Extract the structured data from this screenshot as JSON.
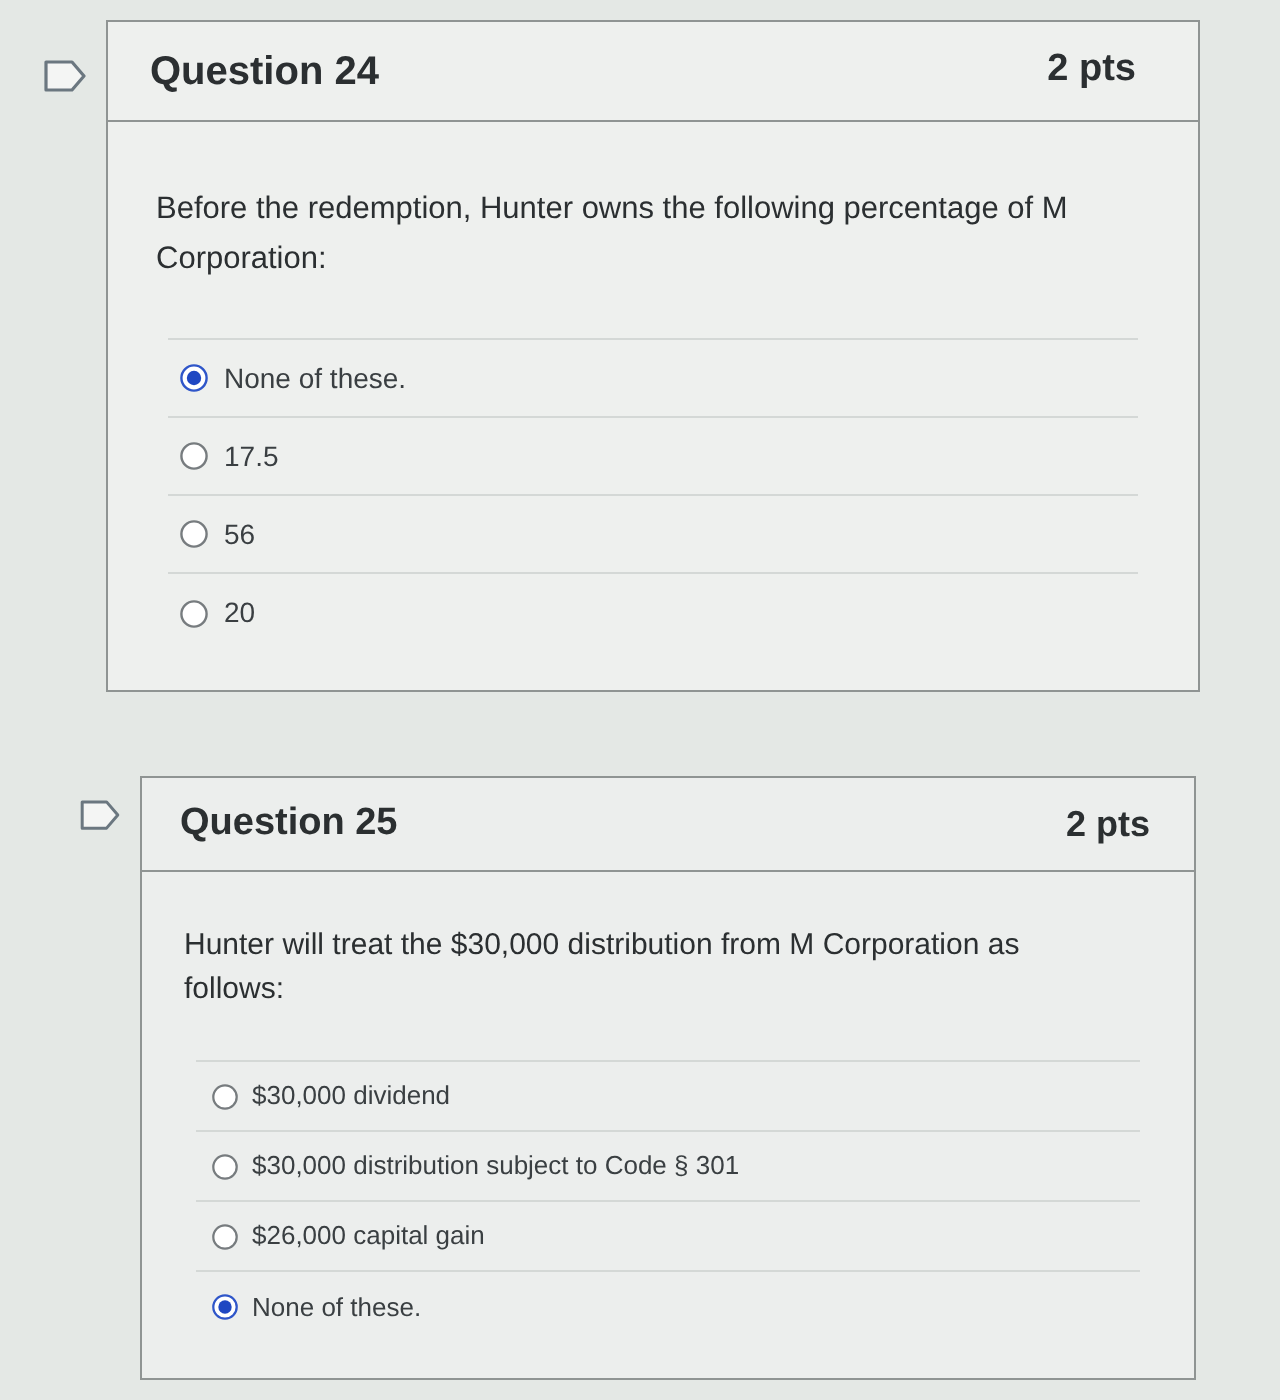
{
  "questions": [
    {
      "title": "Question 24",
      "points": "2 pts",
      "flagged": false,
      "prompt": "Before the redemption, Hunter owns the following percentage of M Corporation:",
      "answers": [
        {
          "label": "None of these.",
          "selected": true
        },
        {
          "label": "17.5",
          "selected": false
        },
        {
          "label": "56",
          "selected": false
        },
        {
          "label": "20",
          "selected": false
        }
      ]
    },
    {
      "title": "Question 25",
      "points": "2 pts",
      "flagged": false,
      "prompt": "Hunter will treat the $30,000 distribution from M Corporation as follows:",
      "answers": [
        {
          "label": "$30,000 dividend",
          "selected": false
        },
        {
          "label": "$30,000 distribution subject to Code § 301",
          "selected": false
        },
        {
          "label": "$26,000 capital gain",
          "selected": false
        },
        {
          "label": "None of these.",
          "selected": true
        }
      ]
    }
  ]
}
